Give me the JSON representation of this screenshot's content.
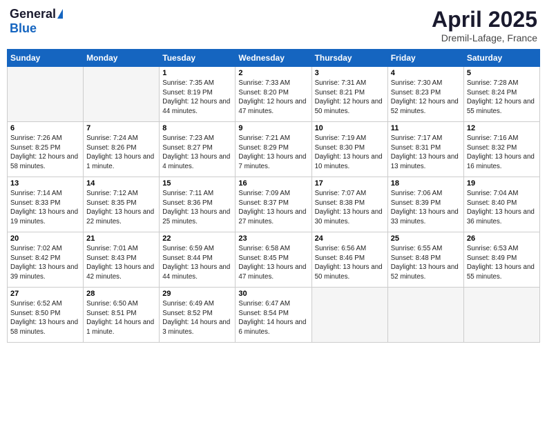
{
  "header": {
    "logo_general": "General",
    "logo_blue": "Blue",
    "title": "April 2025",
    "location": "Dremil-Lafage, France"
  },
  "weekdays": [
    "Sunday",
    "Monday",
    "Tuesday",
    "Wednesday",
    "Thursday",
    "Friday",
    "Saturday"
  ],
  "weeks": [
    [
      {
        "day": "",
        "info": ""
      },
      {
        "day": "",
        "info": ""
      },
      {
        "day": "1",
        "info": "Sunrise: 7:35 AM\nSunset: 8:19 PM\nDaylight: 12 hours and 44 minutes."
      },
      {
        "day": "2",
        "info": "Sunrise: 7:33 AM\nSunset: 8:20 PM\nDaylight: 12 hours and 47 minutes."
      },
      {
        "day": "3",
        "info": "Sunrise: 7:31 AM\nSunset: 8:21 PM\nDaylight: 12 hours and 50 minutes."
      },
      {
        "day": "4",
        "info": "Sunrise: 7:30 AM\nSunset: 8:23 PM\nDaylight: 12 hours and 52 minutes."
      },
      {
        "day": "5",
        "info": "Sunrise: 7:28 AM\nSunset: 8:24 PM\nDaylight: 12 hours and 55 minutes."
      }
    ],
    [
      {
        "day": "6",
        "info": "Sunrise: 7:26 AM\nSunset: 8:25 PM\nDaylight: 12 hours and 58 minutes."
      },
      {
        "day": "7",
        "info": "Sunrise: 7:24 AM\nSunset: 8:26 PM\nDaylight: 13 hours and 1 minute."
      },
      {
        "day": "8",
        "info": "Sunrise: 7:23 AM\nSunset: 8:27 PM\nDaylight: 13 hours and 4 minutes."
      },
      {
        "day": "9",
        "info": "Sunrise: 7:21 AM\nSunset: 8:29 PM\nDaylight: 13 hours and 7 minutes."
      },
      {
        "day": "10",
        "info": "Sunrise: 7:19 AM\nSunset: 8:30 PM\nDaylight: 13 hours and 10 minutes."
      },
      {
        "day": "11",
        "info": "Sunrise: 7:17 AM\nSunset: 8:31 PM\nDaylight: 13 hours and 13 minutes."
      },
      {
        "day": "12",
        "info": "Sunrise: 7:16 AM\nSunset: 8:32 PM\nDaylight: 13 hours and 16 minutes."
      }
    ],
    [
      {
        "day": "13",
        "info": "Sunrise: 7:14 AM\nSunset: 8:33 PM\nDaylight: 13 hours and 19 minutes."
      },
      {
        "day": "14",
        "info": "Sunrise: 7:12 AM\nSunset: 8:35 PM\nDaylight: 13 hours and 22 minutes."
      },
      {
        "day": "15",
        "info": "Sunrise: 7:11 AM\nSunset: 8:36 PM\nDaylight: 13 hours and 25 minutes."
      },
      {
        "day": "16",
        "info": "Sunrise: 7:09 AM\nSunset: 8:37 PM\nDaylight: 13 hours and 27 minutes."
      },
      {
        "day": "17",
        "info": "Sunrise: 7:07 AM\nSunset: 8:38 PM\nDaylight: 13 hours and 30 minutes."
      },
      {
        "day": "18",
        "info": "Sunrise: 7:06 AM\nSunset: 8:39 PM\nDaylight: 13 hours and 33 minutes."
      },
      {
        "day": "19",
        "info": "Sunrise: 7:04 AM\nSunset: 8:40 PM\nDaylight: 13 hours and 36 minutes."
      }
    ],
    [
      {
        "day": "20",
        "info": "Sunrise: 7:02 AM\nSunset: 8:42 PM\nDaylight: 13 hours and 39 minutes."
      },
      {
        "day": "21",
        "info": "Sunrise: 7:01 AM\nSunset: 8:43 PM\nDaylight: 13 hours and 42 minutes."
      },
      {
        "day": "22",
        "info": "Sunrise: 6:59 AM\nSunset: 8:44 PM\nDaylight: 13 hours and 44 minutes."
      },
      {
        "day": "23",
        "info": "Sunrise: 6:58 AM\nSunset: 8:45 PM\nDaylight: 13 hours and 47 minutes."
      },
      {
        "day": "24",
        "info": "Sunrise: 6:56 AM\nSunset: 8:46 PM\nDaylight: 13 hours and 50 minutes."
      },
      {
        "day": "25",
        "info": "Sunrise: 6:55 AM\nSunset: 8:48 PM\nDaylight: 13 hours and 52 minutes."
      },
      {
        "day": "26",
        "info": "Sunrise: 6:53 AM\nSunset: 8:49 PM\nDaylight: 13 hours and 55 minutes."
      }
    ],
    [
      {
        "day": "27",
        "info": "Sunrise: 6:52 AM\nSunset: 8:50 PM\nDaylight: 13 hours and 58 minutes."
      },
      {
        "day": "28",
        "info": "Sunrise: 6:50 AM\nSunset: 8:51 PM\nDaylight: 14 hours and 1 minute."
      },
      {
        "day": "29",
        "info": "Sunrise: 6:49 AM\nSunset: 8:52 PM\nDaylight: 14 hours and 3 minutes."
      },
      {
        "day": "30",
        "info": "Sunrise: 6:47 AM\nSunset: 8:54 PM\nDaylight: 14 hours and 6 minutes."
      },
      {
        "day": "",
        "info": ""
      },
      {
        "day": "",
        "info": ""
      },
      {
        "day": "",
        "info": ""
      }
    ]
  ]
}
